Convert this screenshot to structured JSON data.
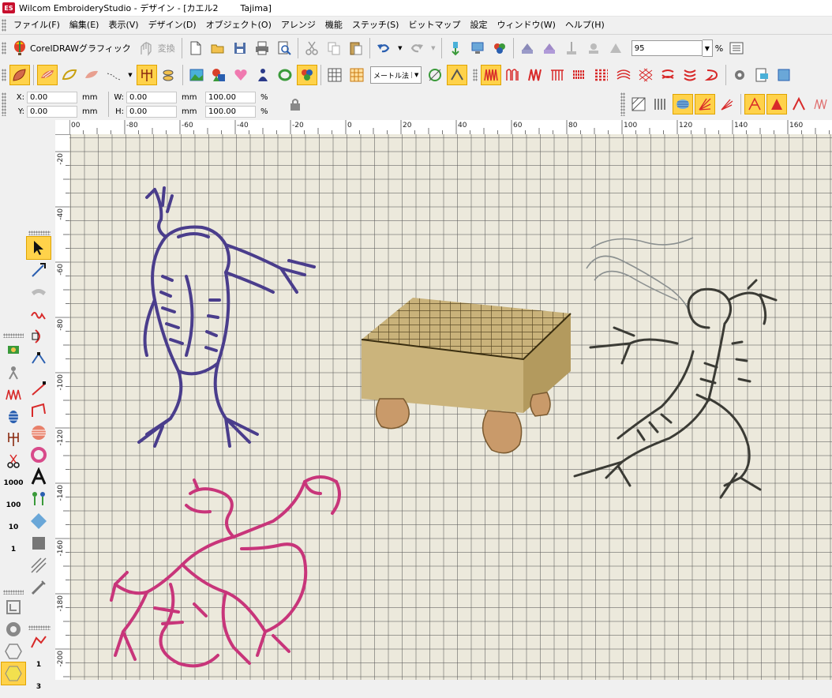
{
  "window": {
    "title": "Wilcom EmbroideryStudio - デザイン - [カエル2        Tajima]",
    "app_icon_text": "ES"
  },
  "menu": [
    "ファイル(F)",
    "編集(E)",
    "表示(V)",
    "デザイン(D)",
    "オブジェクト(O)",
    "アレンジ",
    "機能",
    "ステッチ(S)",
    "ビットマップ",
    "設定",
    "ウィンドウ(W)",
    "ヘルプ(H)"
  ],
  "toolbar1": {
    "corel_label": "CorelDRAWグラフィック",
    "convert_label": "変換",
    "zoom_value": "95",
    "zoom_unit": "%"
  },
  "toolbar2": {
    "units_label": "メートル法"
  },
  "coords": {
    "x_label": "X:",
    "x_value": "0.00",
    "x_unit": "mm",
    "y_label": "Y:",
    "y_value": "0.00",
    "y_unit": "mm",
    "w_label": "W:",
    "w_value": "0.00",
    "w_unit": "mm",
    "h_label": "H:",
    "h_value": "0.00",
    "h_unit": "mm",
    "w_scale": "100.00",
    "h_scale": "100.00",
    "scale_unit": "%"
  },
  "ruler_top_labels": [
    "00",
    "-80",
    "-60",
    "-40",
    "-20",
    "0",
    "20",
    "40",
    "60",
    "80",
    "100",
    "120",
    "140",
    "160"
  ],
  "ruler_left_labels": [
    "-20",
    "-40",
    "-60",
    "-80",
    "-100",
    "-120",
    "-140",
    "-160",
    "-180",
    "-200"
  ],
  "left_tool_numbers": [
    "1000",
    "100",
    "10",
    "1",
    "1",
    "1",
    "3"
  ],
  "colors": {
    "accent_active": "#ffd24a",
    "thread_purple": "#4a3d8c",
    "thread_magenta": "#c8357a",
    "thread_dark": "#3b3b35",
    "board_tan": "#c9b27a",
    "canvas_bg": "#ece9dc"
  },
  "designs": [
    "frog-purple-standing",
    "go-board",
    "frog-dark-dancing",
    "frog-magenta-tumbling"
  ]
}
